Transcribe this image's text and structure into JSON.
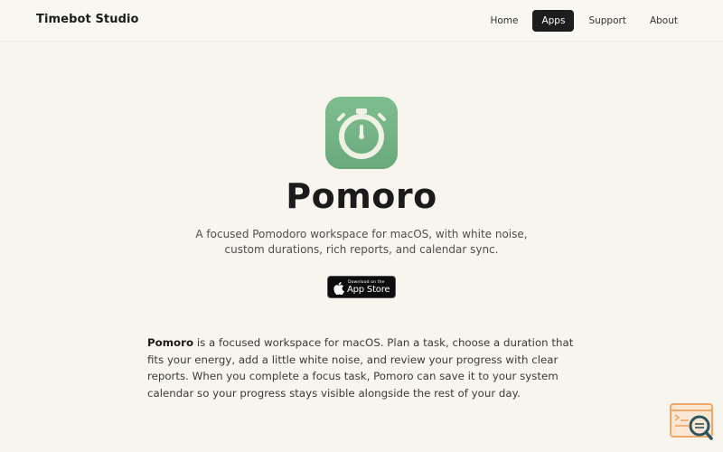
{
  "header": {
    "brand": "Timebot Studio",
    "nav": [
      {
        "label": "Home",
        "active": false
      },
      {
        "label": "Apps",
        "active": true
      },
      {
        "label": "Support",
        "active": false
      },
      {
        "label": "About",
        "active": false
      }
    ]
  },
  "hero": {
    "icon": "stopwatch-icon",
    "title": "Pomoro",
    "subtitle": "A focused Pomodoro workspace for macOS, with white noise, custom durations, rich reports, and calendar sync.",
    "badge": {
      "small": "Download on the",
      "big": "App Store",
      "icon": "apple-icon"
    }
  },
  "description": {
    "bold": "Pomoro",
    "text": " is a focused workspace for macOS. Plan a task, choose a duration that fits your energy, add a little white noise, and review your progress with clear reports. When you complete a focus task, Pomoro can save it to your system calendar so your progress stays visible alongside the rest of your day."
  },
  "widget": {
    "icon": "search-console-icon"
  },
  "colors": {
    "background": "#f8f5ee",
    "icon_green": "#72b083",
    "nav_active": "#1d1d1d",
    "widget_orange": "#f0a86a"
  }
}
